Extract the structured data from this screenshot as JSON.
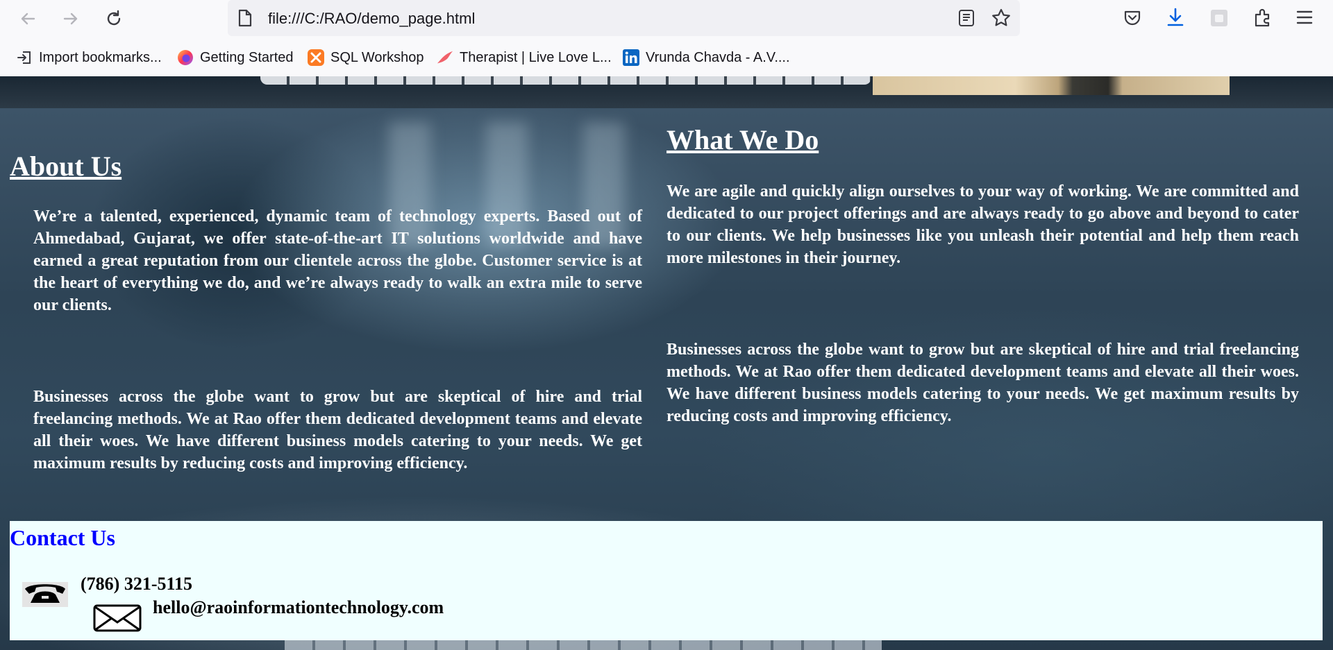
{
  "browser": {
    "url": "file:///C:/RAO/demo_page.html",
    "bookmarks": [
      {
        "label": "Import bookmarks...",
        "icon": "import-icon"
      },
      {
        "label": "Getting Started",
        "icon": "firefox-icon"
      },
      {
        "label": "SQL Workshop",
        "icon": "xampp-icon"
      },
      {
        "label": "Therapist | Live Love L...",
        "icon": "bird-icon"
      },
      {
        "label": "Vrunda Chavda - A.V....",
        "icon": "linkedin-icon"
      }
    ]
  },
  "about": {
    "heading": "About Us",
    "p1": "We’re a talented, experienced, dynamic team of technology experts. Based out of Ahmedabad, Gujarat, we offer state-of-the-art IT solutions worldwide and have earned a great reputation from our clientele across the globe. Customer service is at the heart of everything we do, and we’re always ready to walk an extra mile to serve our clients.",
    "p2": "Businesses across the globe want to grow but are skeptical of hire and trial freelancing methods. We at Rao offer them dedicated development teams and elevate all their woes. We have different business models catering to your needs. We get maximum results by reducing costs and improving efficiency."
  },
  "what": {
    "heading": "What We Do",
    "p1": "We are agile and quickly align ourselves to your way of working. We are committed and dedicated to our project offerings and are always ready to go above and beyond to cater to our clients. We help businesses like you unleash their potential and help them reach more milestones in their journey.",
    "p2": "Businesses across the globe want to grow but are skeptical of hire and trial freelancing methods. We at Rao offer them dedicated development teams and elevate all their woes. We have different business models catering to your needs. We get maximum results by reducing costs and improving efficiency."
  },
  "contact": {
    "heading": "Contact Us",
    "phone": "(786) 321-5115",
    "email": "hello@raoinformationtechnology.com"
  },
  "colors": {
    "contact_heading": "#0000ff",
    "contact_bg": "#f0ffff",
    "section_text": "#ffffff"
  }
}
